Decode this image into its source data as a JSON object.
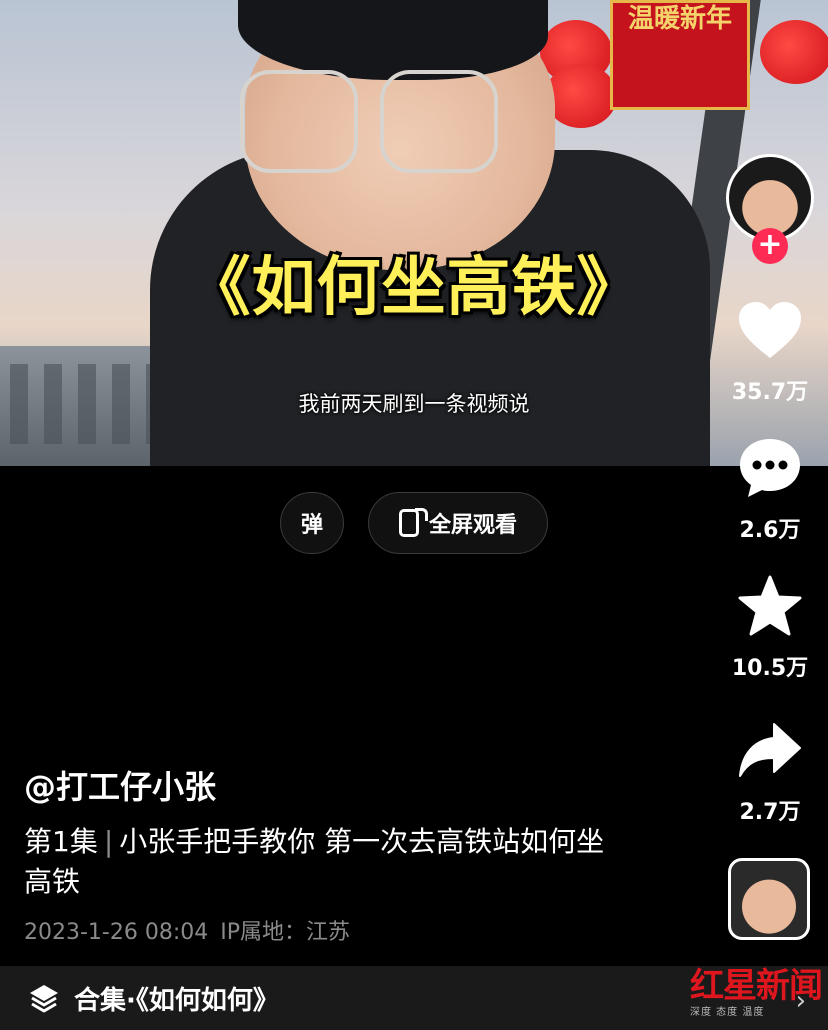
{
  "video": {
    "title_overlay": "《如何坐高铁》",
    "subtitle": "我前两天刷到一条视频说",
    "sign_text": "温暖新年"
  },
  "controls": {
    "danmu_label": "弹",
    "fullscreen_label": "全屏观看"
  },
  "actions": {
    "likes": "35.7万",
    "comments": "2.6万",
    "favorites": "10.5万",
    "shares": "2.7万"
  },
  "post": {
    "author": "@打工仔小张",
    "episode": "第1集",
    "separator": "|",
    "description": "小张手把手教你 第一次去高铁站如何坐高铁",
    "datetime": "2023-1-26 08:04",
    "ip_label": "IP属地：江苏"
  },
  "collection": {
    "label": "合集·《如何如何》"
  },
  "watermark": {
    "brand": "红星新闻",
    "tagline": "深度 态度 温度"
  },
  "colors": {
    "accent": "#fe2c55",
    "title_yellow": "#fff05a",
    "muted": "#8a8a8a"
  }
}
